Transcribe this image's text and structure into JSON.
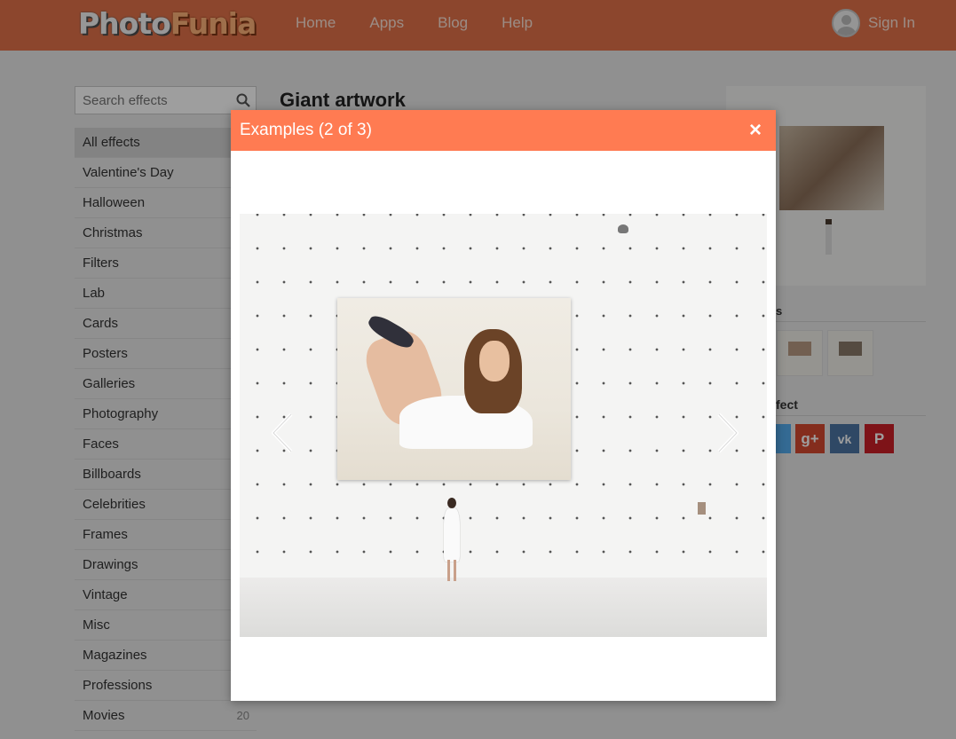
{
  "header": {
    "logo_part1": "Photo",
    "logo_part2": "Funia",
    "nav": [
      "Home",
      "Apps",
      "Blog",
      "Help"
    ],
    "sign_in": "Sign In"
  },
  "search": {
    "placeholder": "Search effects"
  },
  "sidebar": {
    "items": [
      {
        "label": "All effects",
        "count": ""
      },
      {
        "label": "Valentine's Day",
        "count": ""
      },
      {
        "label": "Halloween",
        "count": ""
      },
      {
        "label": "Christmas",
        "count": ""
      },
      {
        "label": "Filters",
        "count": ""
      },
      {
        "label": "Lab",
        "count": ""
      },
      {
        "label": "Cards",
        "count": ""
      },
      {
        "label": "Posters",
        "count": ""
      },
      {
        "label": "Galleries",
        "count": ""
      },
      {
        "label": "Photography",
        "count": ""
      },
      {
        "label": "Faces",
        "count": ""
      },
      {
        "label": "Billboards",
        "count": ""
      },
      {
        "label": "Celebrities",
        "count": ""
      },
      {
        "label": "Frames",
        "count": ""
      },
      {
        "label": "Drawings",
        "count": ""
      },
      {
        "label": "Vintage",
        "count": ""
      },
      {
        "label": "Misc",
        "count": ""
      },
      {
        "label": "Magazines",
        "count": ""
      },
      {
        "label": "Professions",
        "count": ""
      },
      {
        "label": "Movies",
        "count": "20"
      }
    ]
  },
  "main": {
    "title": "Giant artwork",
    "examples_heading_fragment": "s",
    "share_heading_fragment": "fect"
  },
  "modal": {
    "title": "Examples (2 of 3)",
    "close": "×"
  },
  "colors": {
    "header_bg": "#e2724a",
    "modal_header_bg": "#ff7b52"
  }
}
